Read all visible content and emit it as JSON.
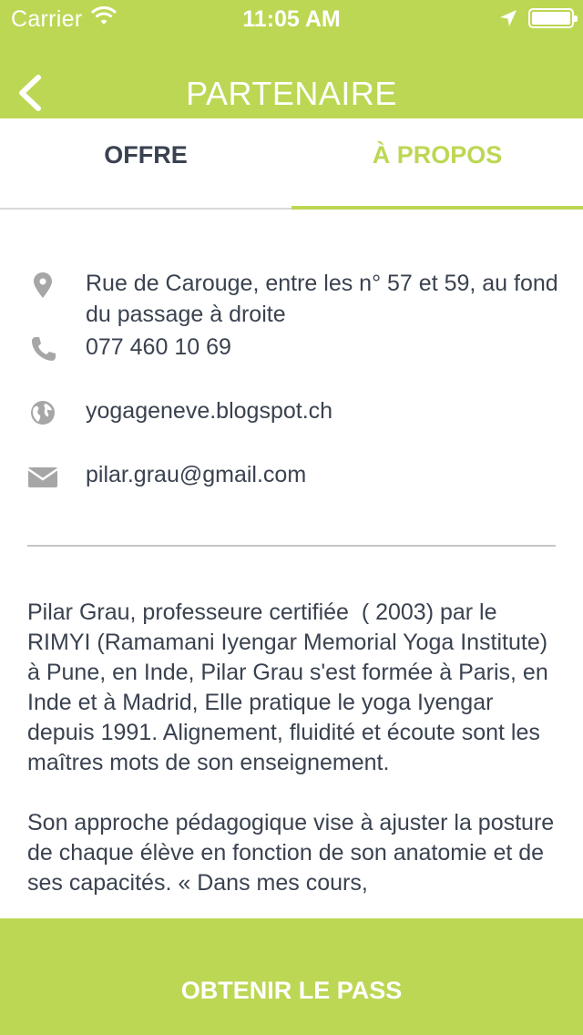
{
  "status_bar": {
    "carrier": "Carrier",
    "time": "11:05 AM",
    "wifi_icon": "wifi-icon",
    "location_icon": "location-arrow-icon",
    "battery_icon": "battery-full-icon"
  },
  "nav": {
    "title": "PARTENAIRE",
    "back_icon": "chevron-left-icon"
  },
  "tabs": [
    {
      "label": "OFFRE",
      "selected": false
    },
    {
      "label": "À PROPOS",
      "selected": true
    }
  ],
  "contact": {
    "address": "Rue de Carouge, entre les n° 57 et 59, au fond du passage à droite",
    "phone": "077 460 10 69",
    "website": "yogageneve.blogspot.ch",
    "email": "pilar.grau@gmail.com"
  },
  "description": {
    "paragraph_1": "Pilar Grau, professeure certifiée  ( 2003) par le RIMYI (Ramamani Iyengar Memorial Yoga Institute) à Pune, en Inde, Pilar Grau s'est formée à Paris, en Inde et à Madrid, Elle pratique le yoga Iyengar depuis 1991. Alignement, fluidité et écoute sont les maîtres mots de son enseignement.",
    "paragraph_2": "Son approche pédagogique vise à ajuster la posture de chaque élève en fonction de son anatomie et de ses capacités. « Dans mes cours,"
  },
  "cta": {
    "label": "OBTENIR LE PASS"
  },
  "colors": {
    "accent": "#bcd754",
    "text": "#3a4250",
    "icon": "#a6a6a6",
    "divider": "#c6c6c6"
  }
}
